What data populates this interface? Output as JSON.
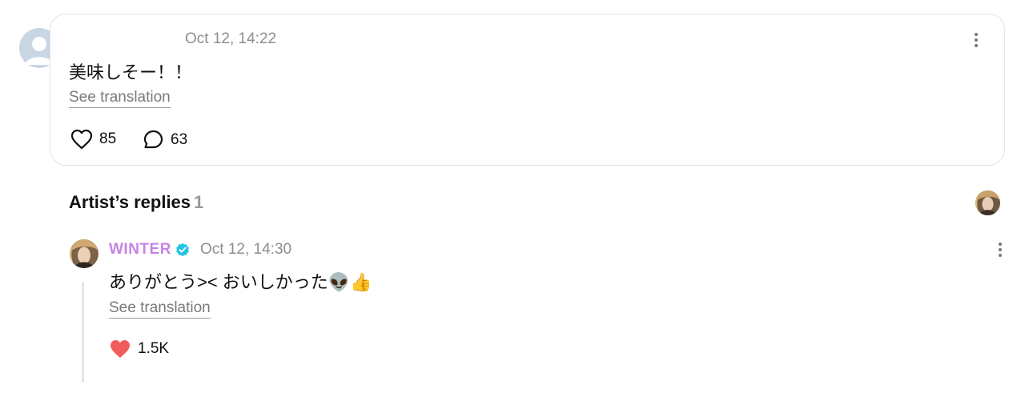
{
  "comment": {
    "time": "Oct 12, 14:22",
    "text": "美味しそー！！",
    "see_translation": "See translation",
    "likes": "85",
    "replies": "63"
  },
  "artist_replies": {
    "title": "Artist’s replies",
    "count": "1"
  },
  "reply": {
    "name": "WINTER",
    "time": "Oct 12, 14:30",
    "text": "ありがとう>< おいしかった👽👍",
    "see_translation": "See translation",
    "likes": "1.5K"
  },
  "colors": {
    "artist_name": "#c583e6",
    "verified_badge": "#22c3e6",
    "liked_heart": "#f25c5c",
    "muted_text": "#8e8e8e"
  },
  "icons": [
    "default-avatar-icon",
    "kebab-menu-icon",
    "heart-outline-icon",
    "comment-bubble-icon",
    "verified-badge-icon",
    "heart-filled-icon"
  ]
}
